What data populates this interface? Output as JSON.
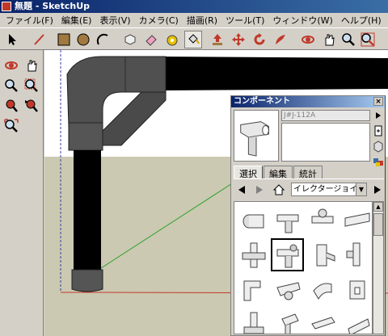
{
  "window": {
    "title": "無題 - SketchUp"
  },
  "menu": [
    "ファイル(F)",
    "編集(E)",
    "表示(V)",
    "カメラ(C)",
    "描画(R)",
    "ツール(T)",
    "ウィンドウ(W)",
    "ヘルプ(H)"
  ],
  "toolbar_icons": [
    "select-icon",
    "pencil-icon",
    "rectangle-icon",
    "circle-icon",
    "arc-icon",
    "make-component-icon",
    "eraser-icon",
    "tape-measure-icon",
    "paint-bucket-icon",
    "push-pull-icon",
    "move-icon",
    "rotate-icon",
    "follow-me-icon",
    "orbit-icon",
    "pan-icon",
    "zoom-icon",
    "zoom-extents-icon"
  ],
  "left_tools": [
    "orbit-icon",
    "pan-icon",
    "zoom-icon",
    "zoom-window-icon",
    "previous-view-icon",
    "next-view-icon",
    "zoom-extents-icon"
  ],
  "components_panel": {
    "title": "コンポーネント",
    "close_label": "×",
    "name_value": "J#J-112A",
    "tabs": [
      "選択",
      "編集",
      "統計"
    ],
    "active_tab": "選択",
    "collection": "イレクタージョイン",
    "selected_index": 5,
    "items": 16
  }
}
